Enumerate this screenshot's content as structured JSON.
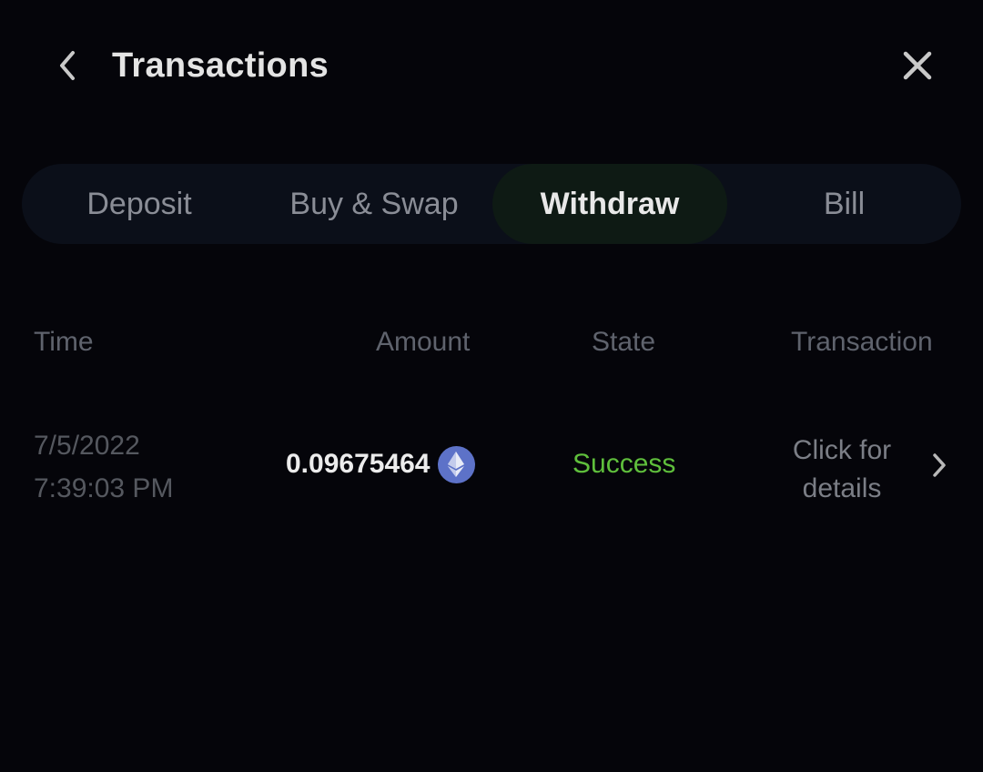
{
  "header": {
    "title": "Transactions",
    "back_icon": "chevron-left-icon",
    "close_icon": "close-icon"
  },
  "tabs": [
    {
      "label": "Deposit",
      "active": false
    },
    {
      "label": "Buy & Swap",
      "active": false
    },
    {
      "label": "Withdraw",
      "active": true
    },
    {
      "label": "Bill",
      "active": false
    }
  ],
  "table": {
    "columns": {
      "time": "Time",
      "amount": "Amount",
      "state": "State",
      "transaction": "Transaction"
    },
    "rows": [
      {
        "date": "7/5/2022",
        "time": "7:39:03 PM",
        "amount": "0.09675464",
        "currency_icon": "ethereum-icon",
        "state": "Success",
        "details_line1": "Click for",
        "details_line2": "details"
      }
    ]
  },
  "colors": {
    "background": "#05050a",
    "success": "#5fbf3c",
    "eth": "#5d72c8",
    "tab_active_bg": "#0e1a14"
  }
}
